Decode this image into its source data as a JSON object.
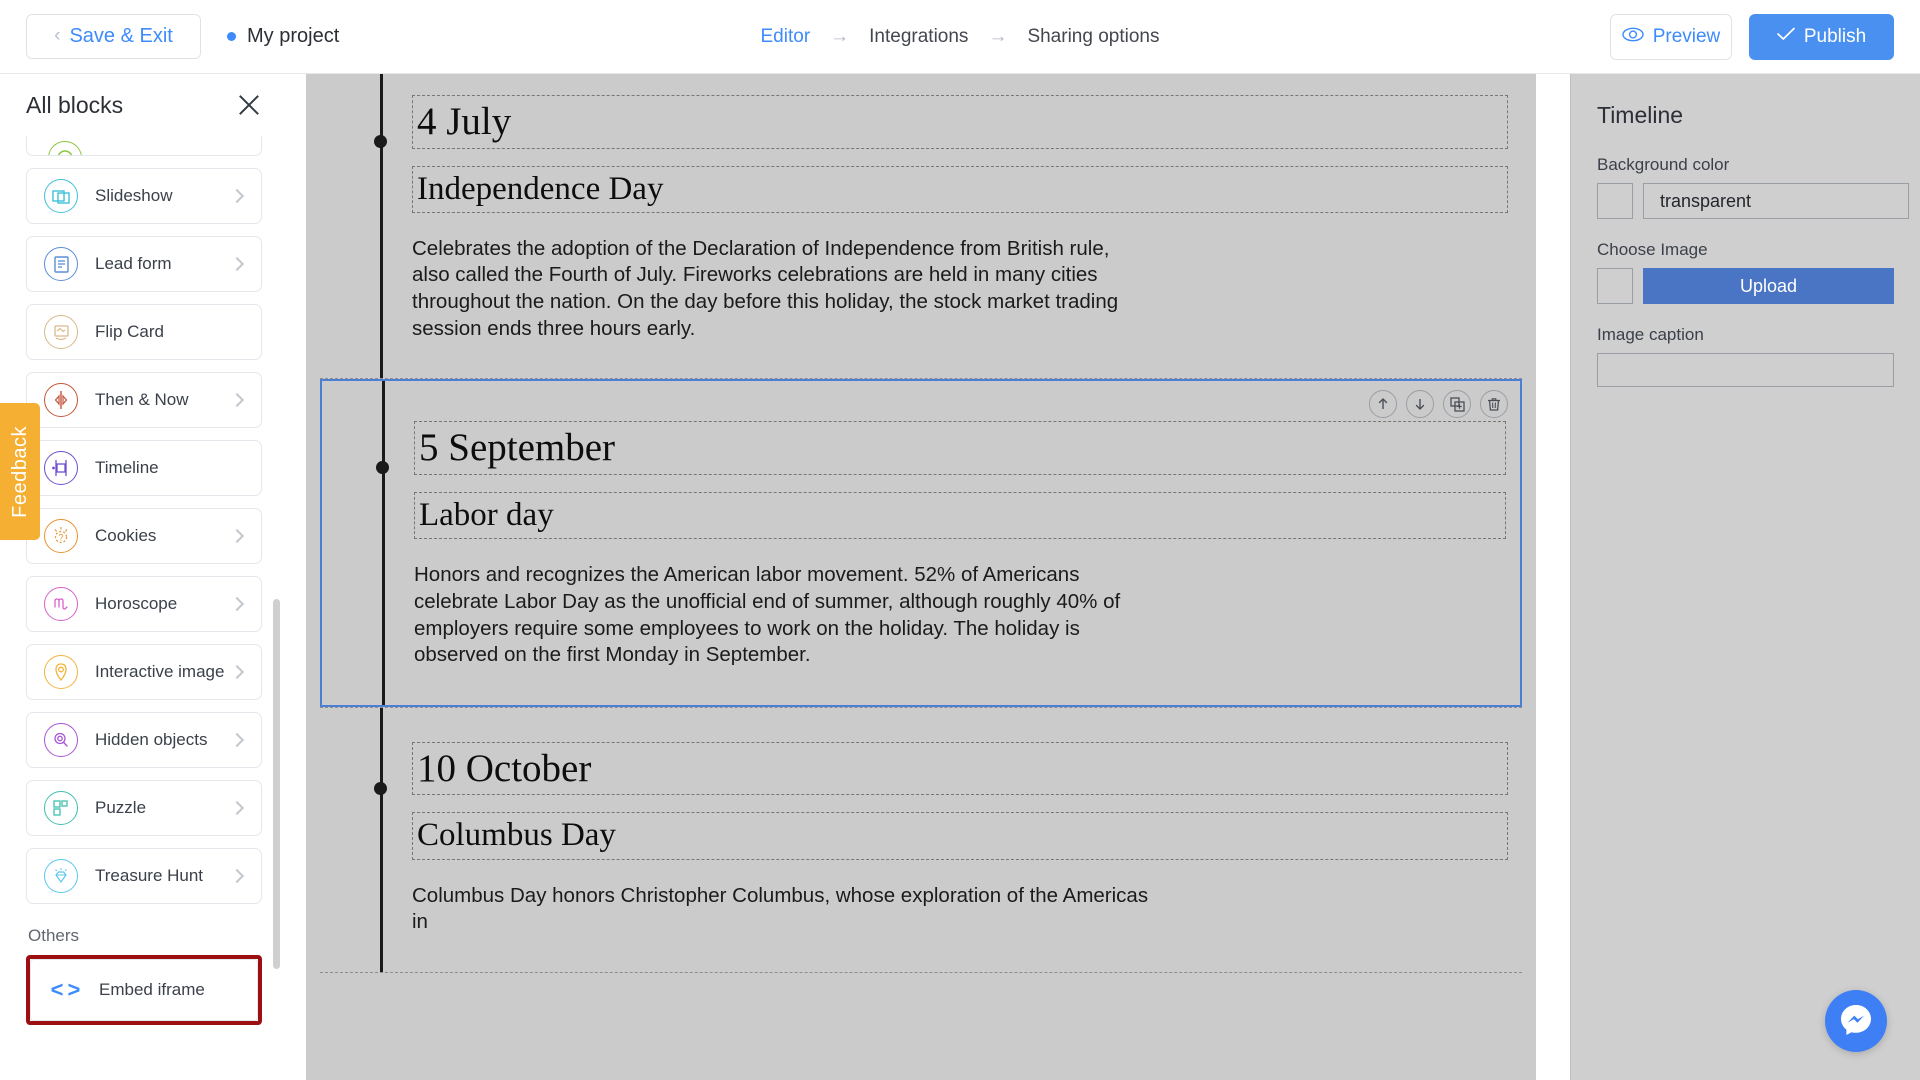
{
  "topbar": {
    "save_exit_label": "Save & Exit",
    "project_name": "My project",
    "breadcrumb": [
      {
        "label": "Editor",
        "active": true
      },
      {
        "label": "Integrations",
        "active": false
      },
      {
        "label": "Sharing options",
        "active": false
      }
    ],
    "preview_label": "Preview",
    "publish_label": "Publish",
    "accent_color": "#3d8bfd",
    "publish_bg": "#4a90f0"
  },
  "sidebar": {
    "title": "All blocks",
    "close_icon": "close-icon",
    "items": [
      {
        "label": "",
        "icon": "partial-block-icon",
        "color": "#8cc63f",
        "partial": true
      },
      {
        "label": "Slideshow",
        "icon": "slideshow-icon",
        "color": "#3fc1d9"
      },
      {
        "label": "Lead form",
        "icon": "lead-form-icon",
        "color": "#5b8ddb"
      },
      {
        "label": "Flip Card",
        "icon": "flip-card-icon",
        "color": "#d9b98a"
      },
      {
        "label": "Then & Now",
        "icon": "then-now-icon",
        "color": "#c4553a"
      },
      {
        "label": "Timeline",
        "icon": "timeline-icon",
        "color": "#6f4fd1"
      },
      {
        "label": "Cookies",
        "icon": "cookies-icon",
        "color": "#e8922e"
      },
      {
        "label": "Horoscope",
        "icon": "horoscope-icon",
        "color": "#d862c8"
      },
      {
        "label": "Interactive image",
        "icon": "interactive-image-icon",
        "color": "#f2b33d"
      },
      {
        "label": "Hidden objects",
        "icon": "hidden-objects-icon",
        "color": "#a855d6"
      },
      {
        "label": "Puzzle",
        "icon": "puzzle-icon",
        "color": "#3fbfae"
      },
      {
        "label": "Treasure Hunt",
        "icon": "treasure-hunt-icon",
        "color": "#5bc8f0"
      }
    ],
    "others_label": "Others",
    "embed_item": {
      "label": "Embed iframe",
      "icon": "code-icon",
      "highlight_color": "#9d1012"
    },
    "feedback_label": "Feedback",
    "feedback_color": "#f5af32"
  },
  "canvas": {
    "blocks": [
      {
        "date": "4 July",
        "title": "Independence Day",
        "body": "Celebrates the adoption of the Declaration of Independence from British rule, also called the Fourth of July. Fireworks celebrations are held in many cities throughout the nation. On the day before this holiday, the stock market trading session ends three hours early.",
        "selected": false
      },
      {
        "date": "5 September",
        "title": "Labor day",
        "body": "Honors and recognizes the American labor movement. 52% of Americans celebrate Labor Day as the unofficial end of summer, although roughly 40% of employers require some employees to work on the holiday. The holiday is observed on the first Monday in September.",
        "selected": true
      },
      {
        "date": "10 October",
        "title": "Columbus Day",
        "body": "Columbus Day honors Christopher Columbus, whose exploration of the Americas in",
        "selected": false
      }
    ],
    "toolbar_icons": [
      "move-up-icon",
      "move-down-icon",
      "duplicate-icon",
      "delete-icon"
    ],
    "selection_color": "#4a7fd4"
  },
  "right_panel": {
    "title": "Timeline",
    "background_color_label": "Background color",
    "background_color_value": "transparent",
    "choose_image_label": "Choose Image",
    "upload_label": "Upload",
    "image_caption_label": "Image caption",
    "image_caption_value": "",
    "upload_button_color": "#4a74c4"
  },
  "messenger": {
    "icon": "messenger-icon",
    "color": "#3f7ff5"
  }
}
